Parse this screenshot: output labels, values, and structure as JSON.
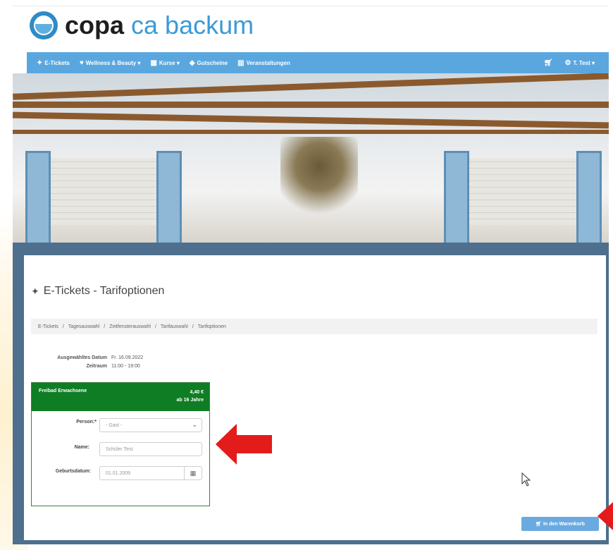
{
  "logo": {
    "part1": "copa",
    "part2": "ca backum"
  },
  "nav": {
    "items": [
      {
        "icon": "ticket-icon",
        "label": "E-Tickets"
      },
      {
        "icon": "heart-icon",
        "label": "Wellness & Beauty"
      },
      {
        "icon": "calendar-icon",
        "label": "Kurse"
      },
      {
        "icon": "tag-icon",
        "label": "Gutscheine"
      },
      {
        "icon": "building-icon",
        "label": "Veranstaltungen"
      }
    ],
    "cart_icon": "cart-icon",
    "user_label": "T. Test",
    "user_icon": "users-icon"
  },
  "page": {
    "title": "E-Tickets - Tarifoptionen",
    "breadcrumbs": [
      "E-Tickets",
      "/",
      "Tagesauswahl",
      "/",
      "Zeitfensterauswahl",
      "/",
      "Tarifauswahl",
      "/",
      "Tarifoptionen"
    ]
  },
  "info": {
    "date_label": "Ausgewähltes Datum",
    "date_value": "Fr. 16.09.2022",
    "time_label": "Zeitraum",
    "time_value": "11:00 - 19:00"
  },
  "card": {
    "title": "Freibad Erwachsene",
    "price": "4,40 €",
    "age": "ab 16 Jahre",
    "person_label": "Person:*",
    "person_value": "- Gast -",
    "name_label": "Name:",
    "name_placeholder": "Schüler Test",
    "birth_label": "Geburtsdatum:",
    "birth_value": "01.01.2009"
  },
  "cart_button": "In den Warenkorb",
  "colors": {
    "nav": "#5aa7e0",
    "card_header": "#0f7d23",
    "arrow": "#e31b1b",
    "frame": "#4e6f8d"
  }
}
